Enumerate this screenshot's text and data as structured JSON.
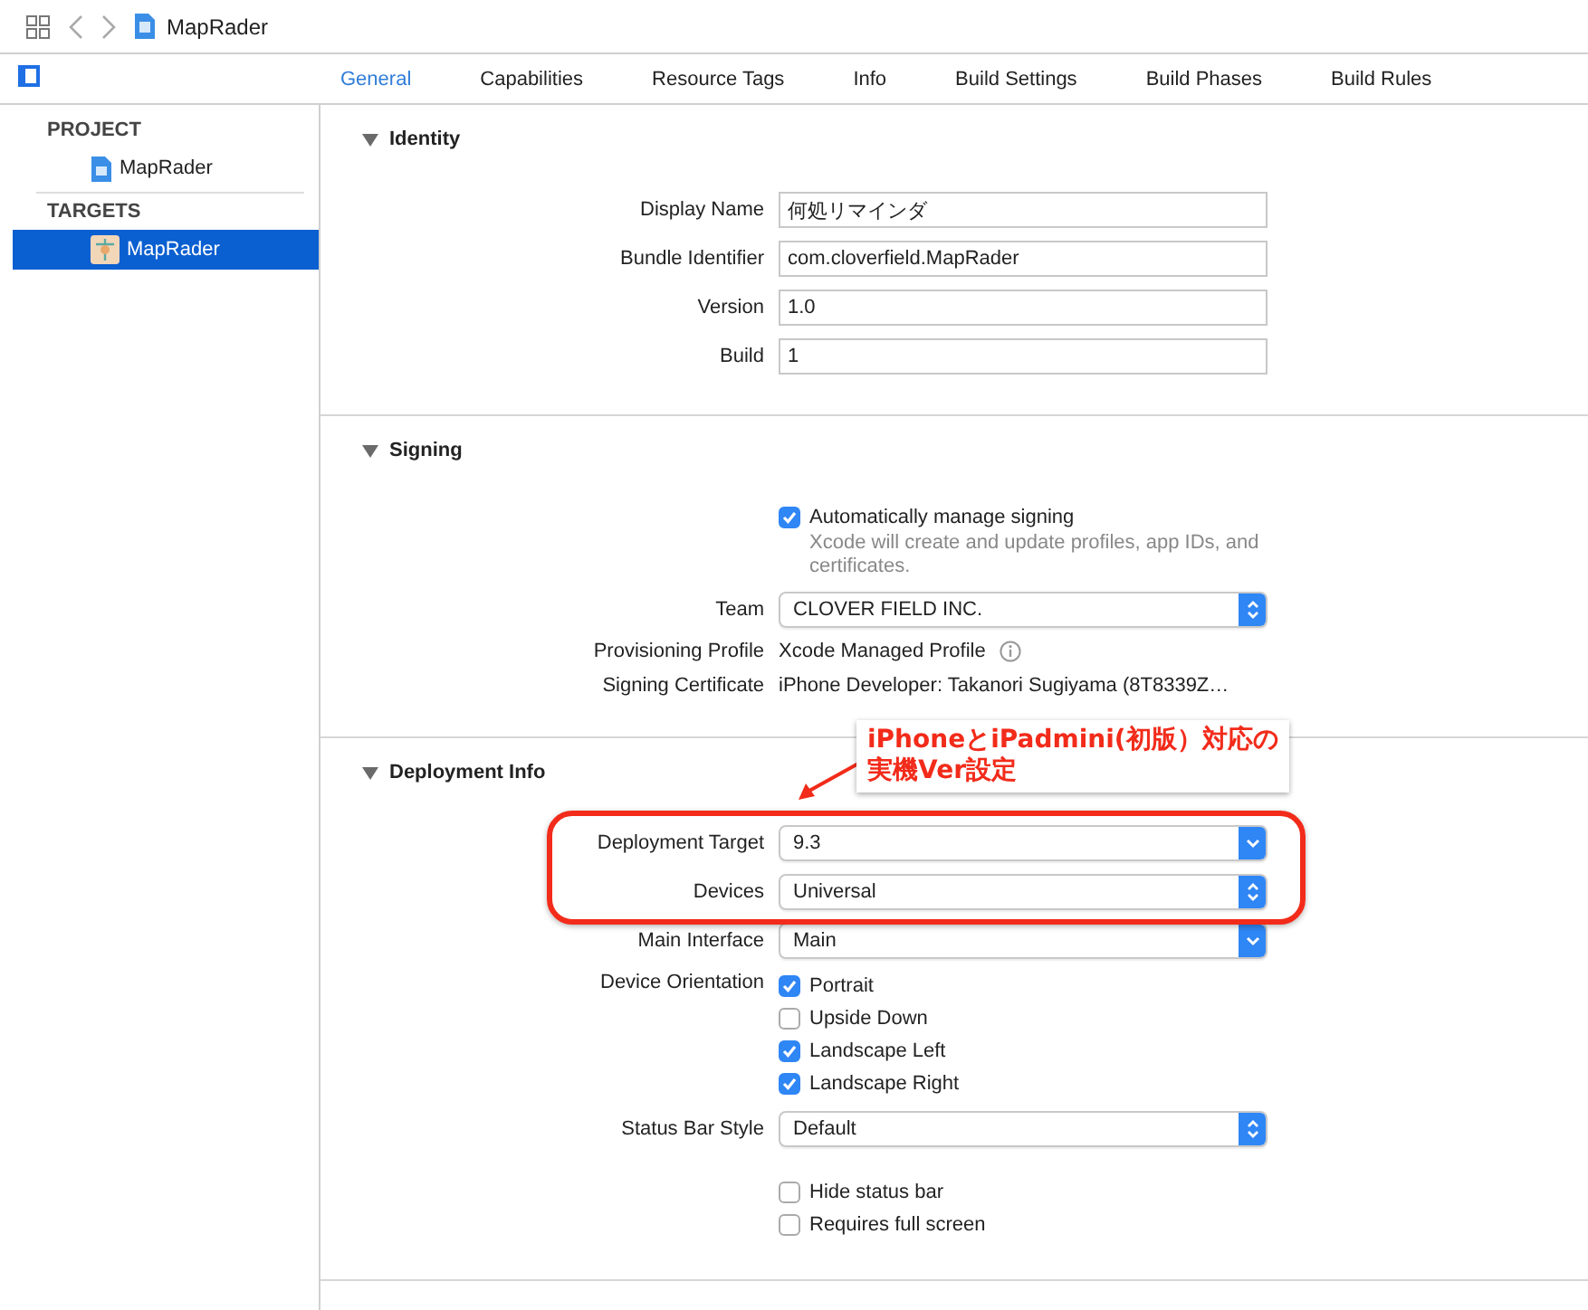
{
  "toolbar": {
    "title": "MapRader"
  },
  "tabs": [
    {
      "label": "General",
      "selected": true
    },
    {
      "label": "Capabilities",
      "selected": false
    },
    {
      "label": "Resource Tags",
      "selected": false
    },
    {
      "label": "Info",
      "selected": false
    },
    {
      "label": "Build Settings",
      "selected": false
    },
    {
      "label": "Build Phases",
      "selected": false
    },
    {
      "label": "Build Rules",
      "selected": false
    }
  ],
  "sidebar": {
    "groups": [
      {
        "header": "PROJECT",
        "items": [
          {
            "label": "MapRader",
            "kind": "project",
            "selected": false
          }
        ]
      },
      {
        "header": "TARGETS",
        "items": [
          {
            "label": "MapRader",
            "kind": "target",
            "selected": true
          }
        ]
      }
    ]
  },
  "sections": [
    {
      "title": "Identity",
      "expanded": true,
      "rows": [
        {
          "kind": "text-field",
          "label": "Display Name",
          "value": "何処リマインダ"
        },
        {
          "kind": "text-field",
          "label": "Bundle Identifier",
          "value": "com.cloverfield.MapRader"
        },
        {
          "kind": "text-field",
          "label": "Version",
          "value": "1.0"
        },
        {
          "kind": "text-field",
          "label": "Build",
          "value": "1"
        }
      ]
    },
    {
      "title": "Signing",
      "expanded": true,
      "rows": [
        {
          "kind": "checkbox",
          "label": "Automatically manage signing",
          "checked": true,
          "note": "Xcode will create and update profiles, app IDs, and certificates."
        },
        {
          "kind": "popup",
          "label": "Team",
          "value": "CLOVER FIELD INC.",
          "stepper": true
        },
        {
          "kind": "value",
          "label": "Provisioning Profile",
          "value": "Xcode Managed Profile",
          "info": true
        },
        {
          "kind": "value",
          "label": "Signing Certificate",
          "value": "iPhone Developer: Takanori Sugiyama (8T8339Z…"
        }
      ]
    },
    {
      "title": "Deployment Info",
      "expanded": true,
      "annotation": {
        "lines": [
          "iPhoneとiPadmini(初版）対応の",
          "実機Ver設定"
        ]
      },
      "rows": [
        {
          "kind": "popup",
          "label": "Deployment Target",
          "value": "9.3",
          "stepper": false,
          "highlighted": true
        },
        {
          "kind": "popup",
          "label": "Devices",
          "value": "Universal",
          "stepper": true,
          "highlighted": true
        },
        {
          "kind": "popup",
          "label": "Main Interface",
          "value": "Main",
          "stepper": false
        },
        {
          "kind": "options",
          "label": "Device Orientation",
          "options": [
            {
              "label": "Portrait",
              "checked": true
            },
            {
              "label": "Upside Down",
              "checked": false
            },
            {
              "label": "Landscape Left",
              "checked": true
            },
            {
              "label": "Landscape Right",
              "checked": true
            }
          ]
        },
        {
          "kind": "popup",
          "label": "Status Bar Style",
          "value": "Default",
          "stepper": true
        },
        {
          "kind": "options",
          "options": [
            {
              "label": "Hide status bar",
              "checked": false
            },
            {
              "label": "Requires full screen",
              "checked": false
            }
          ]
        }
      ]
    }
  ]
}
